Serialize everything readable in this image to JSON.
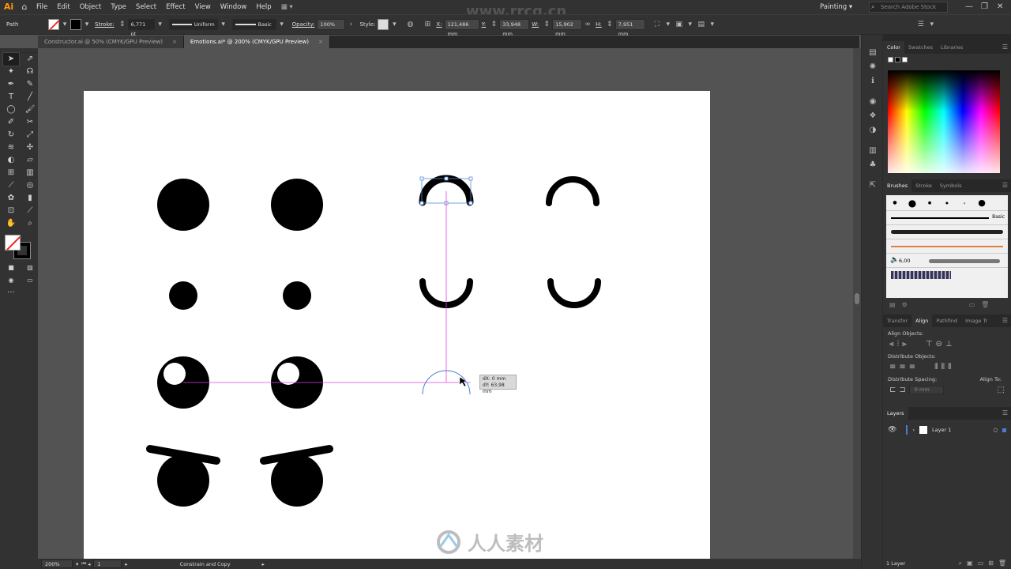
{
  "app": {
    "logo": "Ai",
    "home_icon": "home-icon"
  },
  "menu": [
    "File",
    "Edit",
    "Object",
    "Type",
    "Select",
    "Effect",
    "View",
    "Window",
    "Help"
  ],
  "workspace": "Painting",
  "search_placeholder": "Search Adobe Stock",
  "watermark_top": "www.rrcg.cn",
  "control": {
    "selection": "Path",
    "stroke_label": "Stroke:",
    "stroke_value": "6,771 pt",
    "profile": "Uniform",
    "brush": "Basic",
    "opacity_label": "Opacity:",
    "opacity_value": "100%",
    "style_label": "Style:",
    "x_label": "X:",
    "x_value": "121,486 mm",
    "y_label": "Y:",
    "y_value": "33,948 mm",
    "w_label": "W:",
    "w_value": "15,902 mm",
    "h_label": "H:",
    "h_value": "7,951 mm"
  },
  "tabs": [
    {
      "label": "Constructor.ai @ 50% (CMYK/GPU Preview)",
      "close": "×"
    },
    {
      "label": "Emotions.ai* @ 200% (CMYK/GPU Preview)",
      "close": "×"
    }
  ],
  "tooltip": {
    "dx": "dX: 0 mm",
    "dy": "dY: 63,98 mm"
  },
  "status": {
    "zoom": "200%",
    "artboard": "1",
    "hint": "Constrain and Copy"
  },
  "panels": {
    "color_tabs": [
      "Color",
      "Swatches",
      "Libraries"
    ],
    "brush_tabs": [
      "Brushes",
      "Stroke",
      "Symbols"
    ],
    "brush_basic": "Basic",
    "brush_size": "6,00",
    "align_tabs": [
      "Transfor",
      "Align",
      "Pathfind",
      "Image Tr"
    ],
    "align_objects": "Align Objects:",
    "distribute_objects": "Distribute Objects:",
    "distribute_spacing": "Distribute Spacing:",
    "align_to": "Align To:",
    "spacing_value": "0 mm",
    "layers_title": "Layers",
    "layer_name": "Layer 1",
    "layers_count": "1 Layer"
  },
  "bottom_watermark": "人人素材"
}
